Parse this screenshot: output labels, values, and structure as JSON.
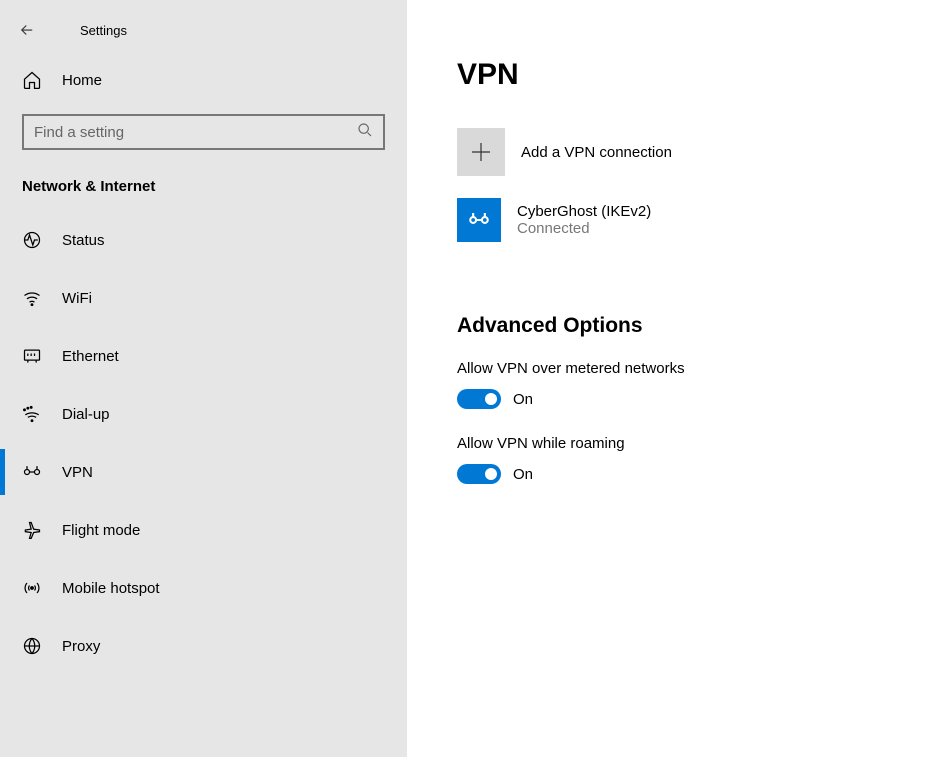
{
  "header": {
    "title": "Settings"
  },
  "sidebar": {
    "home_label": "Home",
    "search_placeholder": "Find a setting",
    "section_title": "Network & Internet",
    "items": [
      {
        "label": "Status",
        "icon": "status"
      },
      {
        "label": "WiFi",
        "icon": "wifi"
      },
      {
        "label": "Ethernet",
        "icon": "ethernet"
      },
      {
        "label": "Dial-up",
        "icon": "dialup"
      },
      {
        "label": "VPN",
        "icon": "vpn",
        "active": true
      },
      {
        "label": "Flight mode",
        "icon": "airplane"
      },
      {
        "label": "Mobile hotspot",
        "icon": "hotspot"
      },
      {
        "label": "Proxy",
        "icon": "proxy"
      }
    ]
  },
  "main": {
    "page_title": "VPN",
    "add_label": "Add a VPN connection",
    "connection": {
      "name": "CyberGhost (IKEv2)",
      "status": "Connected"
    },
    "advanced_title": "Advanced Options",
    "options": [
      {
        "label": "Allow VPN over metered networks",
        "state": "On"
      },
      {
        "label": "Allow VPN while roaming",
        "state": "On"
      }
    ]
  },
  "colors": {
    "accent": "#0078d4",
    "sidebar_bg": "#e6e6e6",
    "annotation": "#ff0000"
  }
}
